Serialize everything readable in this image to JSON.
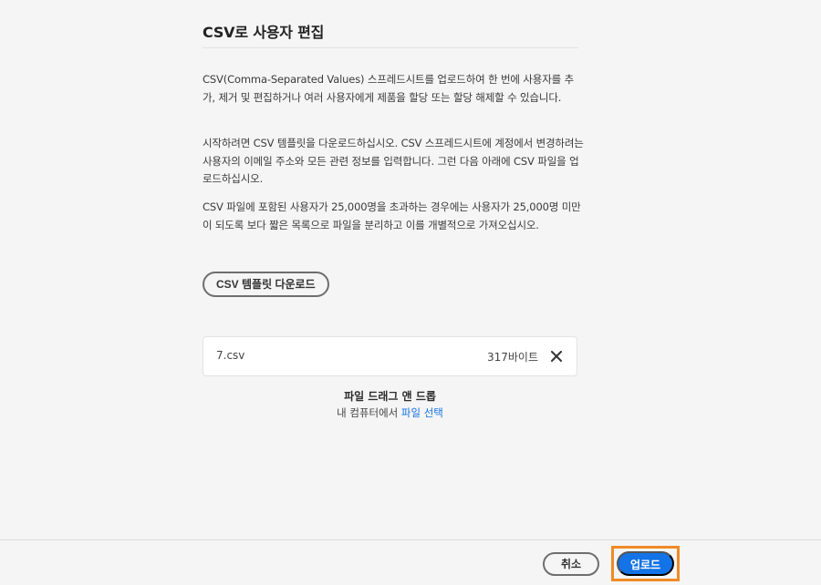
{
  "dialog": {
    "title": "CSV로 사용자 편집",
    "paragraphs": [
      "CSV(Comma-Separated Values) 스프레드시트를 업로드하여 한 번에 사용자를 추가, 제거 및 편집하거나 여러 사용자에게 제품을 할당 또는 할당 해제할 수 있습니다.",
      "시작하려면 CSV 템플릿을 다운로드하십시오. CSV 스프레드시트에 계정에서 변경하려는 사용자의 이메일 주소와 모든 관련 정보를 입력합니다. 그런 다음 아래에 CSV 파일을 업로드하십시오.",
      "CSV 파일에 포함된 사용자가 25,000명을 초과하는 경우에는 사용자가 25,000명 미만이 되도록 보다 짧은 목록으로 파일을 분리하고 이를 개별적으로 가져오십시오."
    ],
    "template_button": "CSV 템플릿 다운로드"
  },
  "file": {
    "name": "7.csv",
    "size": "317바이트",
    "remove_icon": "close-icon"
  },
  "drop_zone": {
    "title": "파일 드래그 앤 드롭",
    "prefix": "내 컴퓨터에서 ",
    "link": "파일 선택"
  },
  "footer": {
    "cancel": "취소",
    "upload": "업로드"
  },
  "colors": {
    "accent": "#1473e6",
    "highlight": "#f08a24"
  }
}
